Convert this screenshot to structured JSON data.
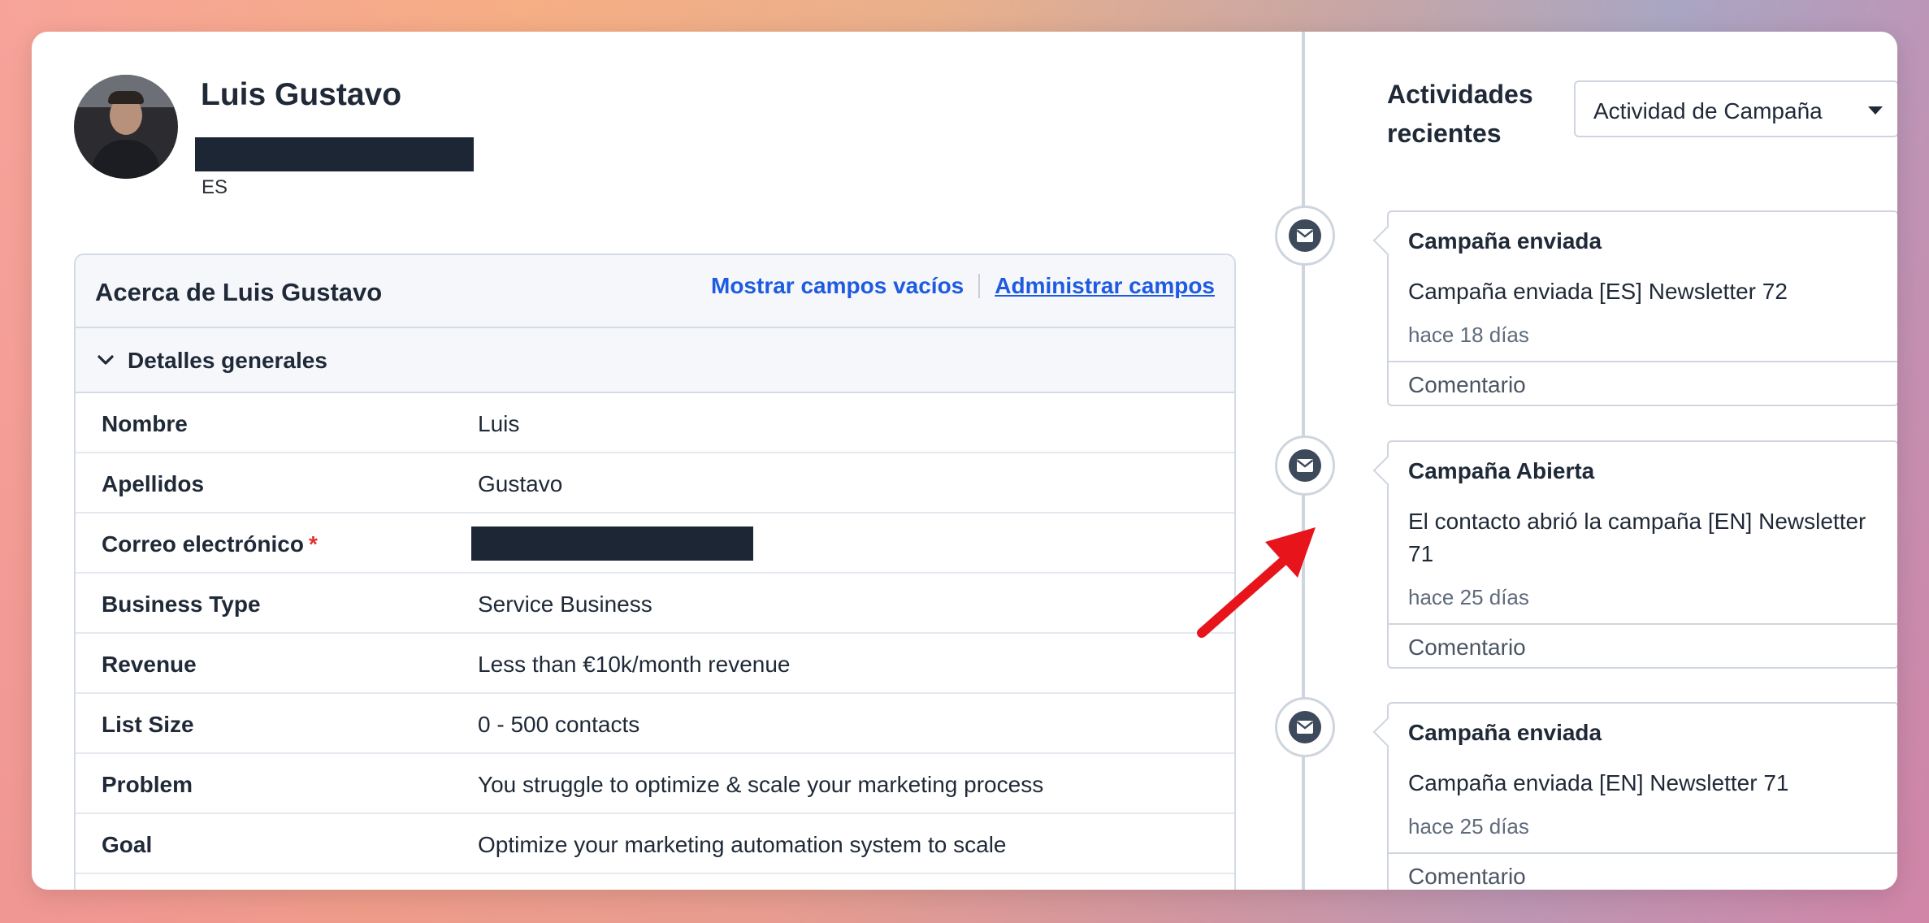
{
  "profile": {
    "name": "Luis Gustavo",
    "country": "ES"
  },
  "about": {
    "title": "Acerca de Luis Gustavo",
    "show_empty_label": "Mostrar campos vacíos",
    "manage_fields_label": "Administrar campos",
    "section_title": "Detalles generales",
    "fields": [
      {
        "label": "Nombre",
        "value": "Luis"
      },
      {
        "label": "Apellidos",
        "value": "Gustavo"
      },
      {
        "label": "Correo electrónico",
        "value": "",
        "required": "*"
      },
      {
        "label": "Business Type",
        "value": "Service Business"
      },
      {
        "label": "Revenue",
        "value": "Less than €10k/month revenue"
      },
      {
        "label": "List Size",
        "value": "0 - 500 contacts"
      },
      {
        "label": "Problem",
        "value": "You struggle to optimize & scale your marketing process"
      },
      {
        "label": "Goal",
        "value": "Optimize your marketing automation system to scale"
      }
    ]
  },
  "activities": {
    "title_line1": "Actividades",
    "title_line2": "recientes",
    "filter_selected": "Actividad de Campaña",
    "events": [
      {
        "title": "Campaña enviada",
        "text": "Campaña enviada [ES] Newsletter 72",
        "time": "hace 18 días",
        "comment": "Comentario"
      },
      {
        "title": "Campaña Abierta",
        "text": "El contacto abrió la campaña [EN] Newsletter 71",
        "time": "hace 25 días",
        "comment": "Comentario"
      },
      {
        "title": "Campaña enviada",
        "text": "Campaña enviada [EN] Newsletter 71",
        "time": "hace 25 días",
        "comment": "Comentario"
      }
    ]
  },
  "colors": {
    "link": "#1e5be0",
    "required": "#e03131",
    "arrow": "#e8141c",
    "icon_bg": "#3d4a5c"
  }
}
